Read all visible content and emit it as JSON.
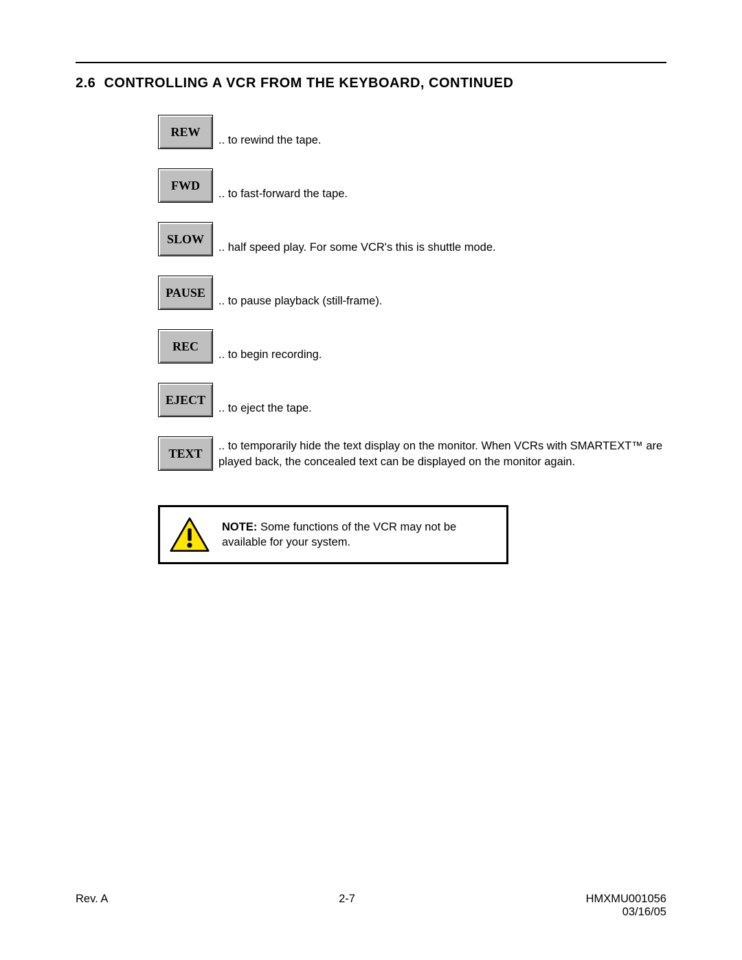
{
  "heading_num": "2.6",
  "heading_title": "CONTROLLING A VCR FROM THE KEYBOARD, CONTINUED",
  "items": [
    {
      "key": "REW",
      "desc": ".. to rewind the tape."
    },
    {
      "key": "FWD",
      "desc": ".. to fast-forward the tape."
    },
    {
      "key": "SLOW",
      "desc": ".. half speed play.  For some VCR's this is shuttle mode."
    },
    {
      "key": "PAUSE",
      "desc": ".. to pause playback (still-frame)."
    },
    {
      "key": "REC",
      "desc": ".. to begin recording."
    },
    {
      "key": "EJECT",
      "desc": ".. to eject the tape."
    },
    {
      "key": "TEXT",
      "desc": ".. to temporarily hide the text display on the monitor.  When VCRs with SMARTEXT™ are played back, the concealed text can be displayed on the monitor again."
    }
  ],
  "note_label": "NOTE:",
  "note_body": "Some functions of the VCR may not be available for your system.",
  "footer": {
    "rev": "Rev. A",
    "page": "2-7",
    "doc": "HMXMU001056",
    "date": "03/16/05"
  }
}
